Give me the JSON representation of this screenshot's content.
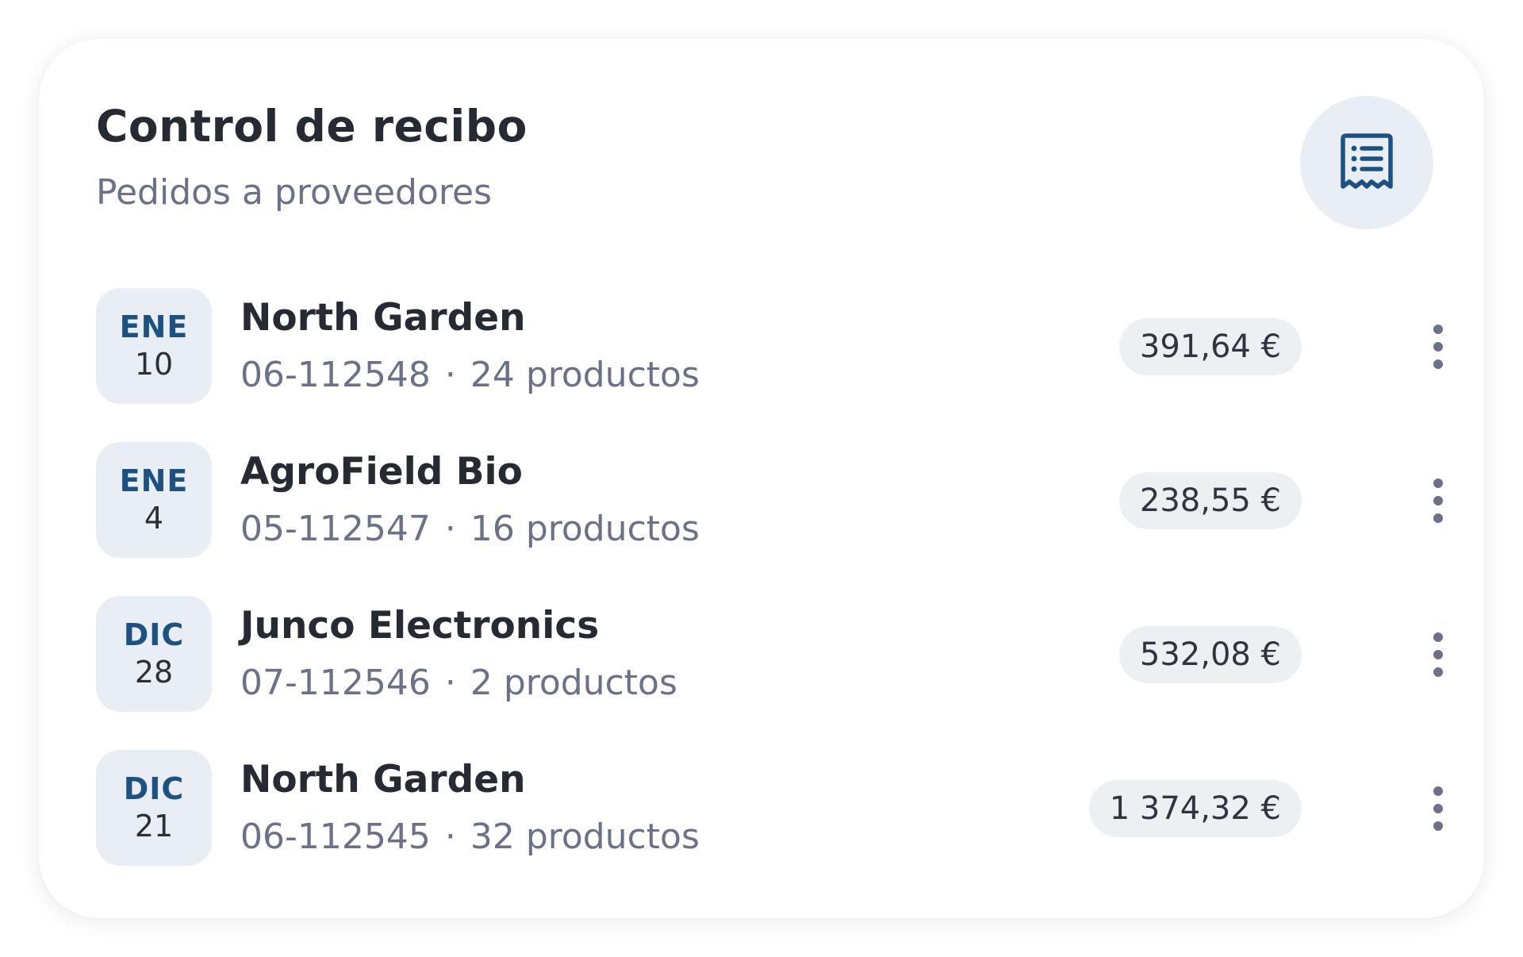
{
  "header": {
    "title": "Control de recibo",
    "subtitle": "Pedidos a proveedores",
    "icon": "receipt-icon"
  },
  "orders": [
    {
      "month": "ENE",
      "day": "10",
      "supplier": "North Garden",
      "order_id": "06-112548",
      "separator": "·",
      "products": "24 productos",
      "amount": "391,64 €"
    },
    {
      "month": "ENE",
      "day": "4",
      "supplier": "AgroField Bio",
      "order_id": "05-112547",
      "separator": "·",
      "products": "16 productos",
      "amount": "238,55 €"
    },
    {
      "month": "DIC",
      "day": "28",
      "supplier": "Junco Electronics",
      "order_id": "07-112546",
      "separator": "·",
      "products": "2 productos",
      "amount": "532,08 €"
    },
    {
      "month": "DIC",
      "day": "21",
      "supplier": "North Garden",
      "order_id": "06-112545",
      "separator": "·",
      "products": "32 productos",
      "amount": "1 374,32 €"
    }
  ],
  "colors": {
    "accent": "#1b5282",
    "badge_bg": "#e8eef3",
    "text_primary": "#252a33",
    "text_secondary": "#6a7189"
  },
  "icons": {
    "row_menu": "more-vertical-icon"
  }
}
